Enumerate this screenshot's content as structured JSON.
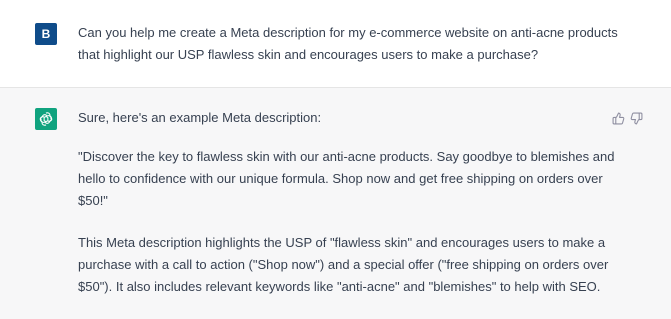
{
  "user": {
    "avatar_letter": "B",
    "message": "Can you help me create a Meta description for my e-commerce website on anti-acne products that highlight our USP flawless skin and encourages users to make a purchase?"
  },
  "assistant": {
    "paragraphs": [
      "Sure, here's an example Meta description:",
      "\"Discover the key to flawless skin with our anti-acne products. Say goodbye to blemishes and hello to confidence with our unique formula. Shop now and get free shipping on orders over $50!\"",
      "This Meta description highlights the USP of \"flawless skin\" and encourages users to make a purchase with a call to action (\"Shop now\") and a special offer (\"free shipping on orders over $50\"). It also includes relevant keywords like \"anti-acne\" and \"blemishes\" to help with SEO."
    ]
  },
  "icons": {
    "assistant_avatar": "openai-logo-icon",
    "feedback_up": "thumbs-up-icon",
    "feedback_down": "thumbs-down-icon"
  },
  "colors": {
    "user_avatar_bg": "#0f4c8a",
    "assistant_avatar_bg": "#10a37f",
    "assistant_bg": "#f7f7f8",
    "text": "#374151"
  }
}
